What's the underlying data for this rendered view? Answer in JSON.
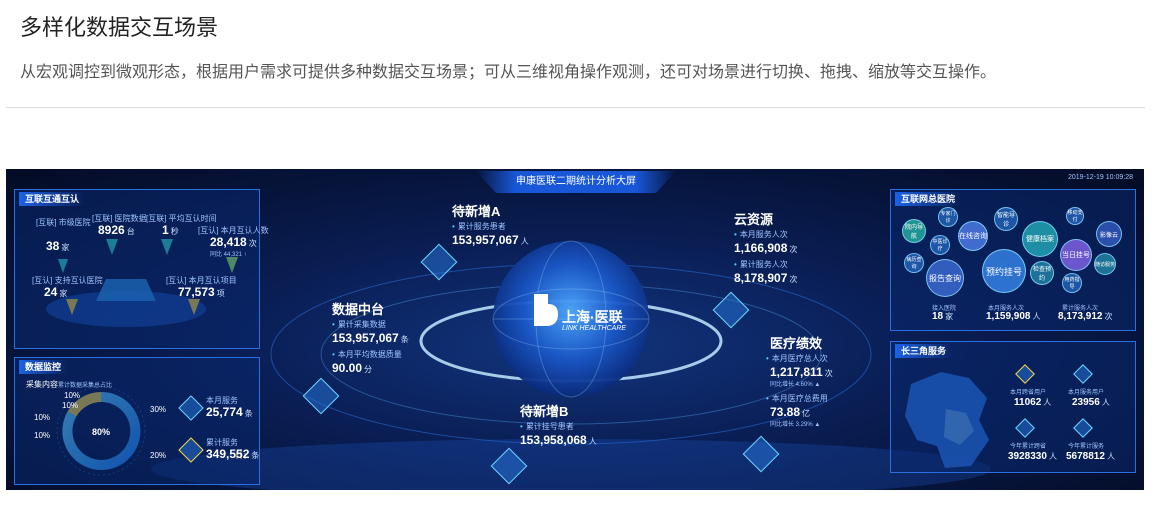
{
  "header": {
    "title": "多样化数据交互场景",
    "description": "从宏观调控到微观形态，根据用户需求可提供多种数据交互场景；可从三维视角操作观测，还可对场景进行切换、拖拽、缩放等交互操作。"
  },
  "dashboard": {
    "title": "申康医联二期统计分析大屏",
    "datetime": "2019-12-19 10:09:28",
    "logo": {
      "cn": "上海·医联",
      "en": "LINK HEALTHCARE"
    },
    "left_top": {
      "heading": "互联互通互认",
      "s1": {
        "label": "[互联] 市级医院",
        "value": "38",
        "unit": "家"
      },
      "s2": {
        "label": "[互联] 医院数据",
        "value": "8926",
        "unit": "台"
      },
      "s3": {
        "label": "[互联] 平均互认时间",
        "value": "1",
        "unit": "秒"
      },
      "s4": {
        "label": "[互认] 本月互认人数",
        "value": "28,418",
        "unit": "次",
        "sub": "同比 44,321 ↑"
      },
      "s5": {
        "label": "[互认] 支持互认医院",
        "value": "24",
        "unit": "家"
      },
      "s6": {
        "label": "[互认] 本月互认项目",
        "value": "77,573",
        "unit": "项"
      }
    },
    "left_bottom": {
      "heading": "数据监控",
      "subheading": "采集内容",
      "legend": "累计数据采集总占比",
      "pcts": [
        "10%",
        "10%",
        "10%",
        "10%",
        "30%",
        "20%"
      ],
      "center": "80%",
      "s1": {
        "label": "本月服务",
        "value": "25,774",
        "unit": "条"
      },
      "s2": {
        "label": "累计服务",
        "value": "349,552",
        "unit": "条"
      }
    },
    "center": {
      "a": {
        "title": "待新增A",
        "label": "累计服务患者",
        "value": "153,957,067",
        "unit": "人"
      },
      "b": {
        "title": "待新增B",
        "label": "累计挂号患者",
        "value": "153,958,068",
        "unit": "人"
      },
      "data": {
        "title": "数据中台",
        "l1": "累计采集数据",
        "v1": "153,957,067",
        "u1": "条",
        "l2": "本月平均数据质量",
        "v2": "90.00",
        "u2": "分"
      },
      "cloud": {
        "title": "云资源",
        "l1": "本月服务人次",
        "v1": "1,166,908",
        "u1": "次",
        "l2": "累计服务人次",
        "v2": "8,178,907",
        "u2": "次"
      },
      "perf": {
        "title": "医疗绩效",
        "l1": "本月医疗总人次",
        "v1": "1,217,811",
        "u1": "次",
        "g1": "同比增长 4.60% ▲",
        "l2": "本月医疗总费用",
        "v2": "73.88",
        "u2": "亿",
        "g2": "同比增长 3.29% ▲"
      }
    },
    "right_top": {
      "heading": "互联网总医院",
      "bubbles": [
        "预约挂号",
        "健康档案",
        "报告查询",
        "在线咨询",
        "当日挂号",
        "智能导诊",
        "院内导航",
        "中医诊疗",
        "专家门诊",
        "检查预约",
        "影像云",
        "移动支付",
        "病历查询",
        "用药指导",
        "随访服务"
      ],
      "s1": {
        "label": "接入医院",
        "value": "18",
        "unit": "家"
      },
      "s2": {
        "label": "本月服务人次",
        "value": "1,159,908",
        "unit": "人"
      },
      "s3": {
        "label": "累计服务人次",
        "value": "8,173,912",
        "unit": "次"
      }
    },
    "right_bottom": {
      "heading": "长三角服务",
      "s1": {
        "label": "本月跨省用户",
        "value": "11062",
        "unit": "人"
      },
      "s2": {
        "label": "本月服务用户",
        "value": "23956",
        "unit": "人"
      },
      "s3": {
        "label": "今年累计跨省",
        "value": "3928330",
        "unit": "人"
      },
      "s4": {
        "label": "今年累计服务",
        "value": "5678812",
        "unit": "人"
      }
    },
    "colors": {
      "bg": "#061338",
      "accent": "#2c6fe0",
      "cyan": "#4fd2ff"
    }
  }
}
